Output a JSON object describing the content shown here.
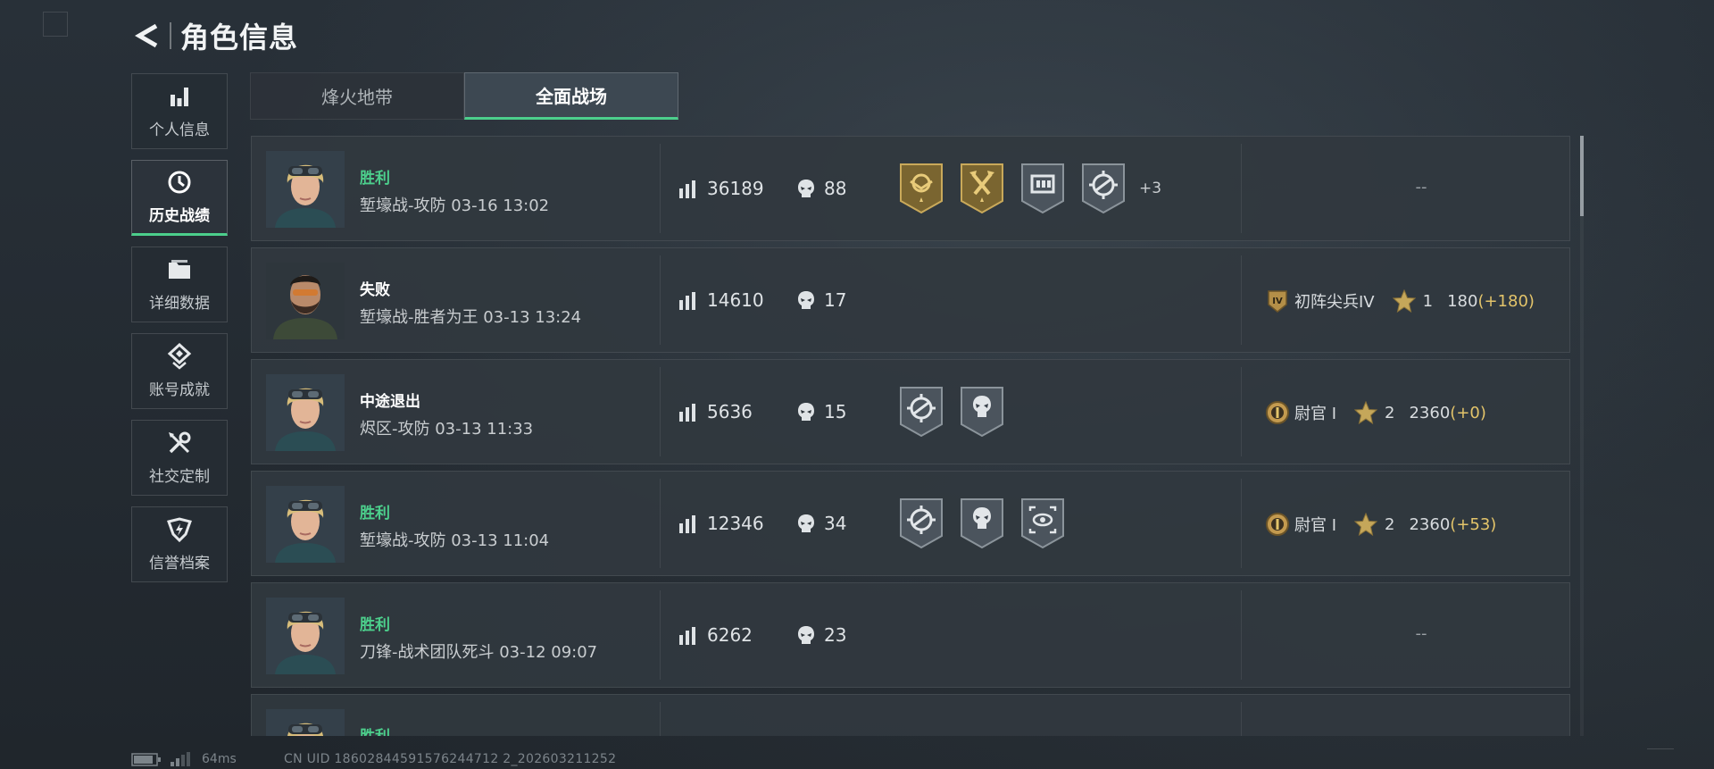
{
  "header": {
    "title": "角色信息"
  },
  "sidebar": {
    "items": [
      {
        "label": "个人信息",
        "icon": "bar-chart-icon",
        "active": false
      },
      {
        "label": "历史战绩",
        "icon": "clock-icon",
        "active": true
      },
      {
        "label": "详细数据",
        "icon": "folder-icon",
        "active": false
      },
      {
        "label": "账号成就",
        "icon": "achievement-icon",
        "active": false
      },
      {
        "label": "社交定制",
        "icon": "tools-icon",
        "active": false
      },
      {
        "label": "信誉档案",
        "icon": "credit-shield-icon",
        "active": false
      }
    ]
  },
  "tabs": [
    {
      "label": "烽火地带",
      "active": false
    },
    {
      "label": "全面战场",
      "active": true
    }
  ],
  "matches": [
    {
      "result": "胜利",
      "result_type": "win",
      "avatar": "female-goggles-avatar",
      "mode": "堑壕战-攻防 03-16 13:02",
      "score": "36189",
      "kills": "88",
      "badges": [
        "gold-eagle-badge",
        "gold-axes-badge",
        "radio-badge",
        "crosshair-badge"
      ],
      "badges_more": "+3",
      "rank": null,
      "no_rank_text": "--"
    },
    {
      "result": "失败",
      "result_type": "lose",
      "avatar": "bearded-soldier-avatar",
      "mode": "堑壕战-胜者为王 03-13 13:24",
      "score": "14610",
      "kills": "17",
      "badges": [],
      "badges_more": "",
      "rank": {
        "emblem": "rank-iv-emblem",
        "name": "初阵尖兵IV",
        "stars": "1",
        "points": "180",
        "delta": "(+180)"
      },
      "no_rank_text": ""
    },
    {
      "result": "中途退出",
      "result_type": "quit",
      "avatar": "female-goggles-avatar",
      "mode": "烬区-攻防 03-13 11:33",
      "score": "5636",
      "kills": "15",
      "badges": [
        "crosshair-badge",
        "skull-badge"
      ],
      "badges_more": "",
      "rank": {
        "emblem": "rank-i-emblem",
        "name": "尉官 I",
        "stars": "2",
        "points": "2360",
        "delta": "(+0)"
      },
      "no_rank_text": ""
    },
    {
      "result": "胜利",
      "result_type": "win",
      "avatar": "female-goggles-avatar",
      "mode": "堑壕战-攻防 03-13 11:04",
      "score": "12346",
      "kills": "34",
      "badges": [
        "crosshair-badge",
        "skull-badge",
        "target-eye-badge"
      ],
      "badges_more": "",
      "rank": {
        "emblem": "rank-i-emblem",
        "name": "尉官 I",
        "stars": "2",
        "points": "2360",
        "delta": "(+53)"
      },
      "no_rank_text": ""
    },
    {
      "result": "胜利",
      "result_type": "win",
      "avatar": "female-goggles-avatar",
      "mode": "刀锋-战术团队死斗 03-12 09:07",
      "score": "6262",
      "kills": "23",
      "badges": [],
      "badges_more": "",
      "rank": null,
      "no_rank_text": "--"
    },
    {
      "result": "胜利",
      "result_type": "win",
      "avatar": "female-goggles-avatar",
      "mode": "",
      "score": "",
      "kills": "",
      "badges": [],
      "badges_more": "",
      "rank": null,
      "no_rank_text": "",
      "partial": true
    }
  ],
  "status": {
    "ping": "64ms",
    "uid": "CN UID 18602844591576244712 2_202603211252",
    "battery_icon": "battery-icon",
    "signal_icon": "signal-icon"
  },
  "colors": {
    "accent_green": "#4ccf8c",
    "gold": "#e3c46a",
    "row_bg": "#31383f"
  }
}
